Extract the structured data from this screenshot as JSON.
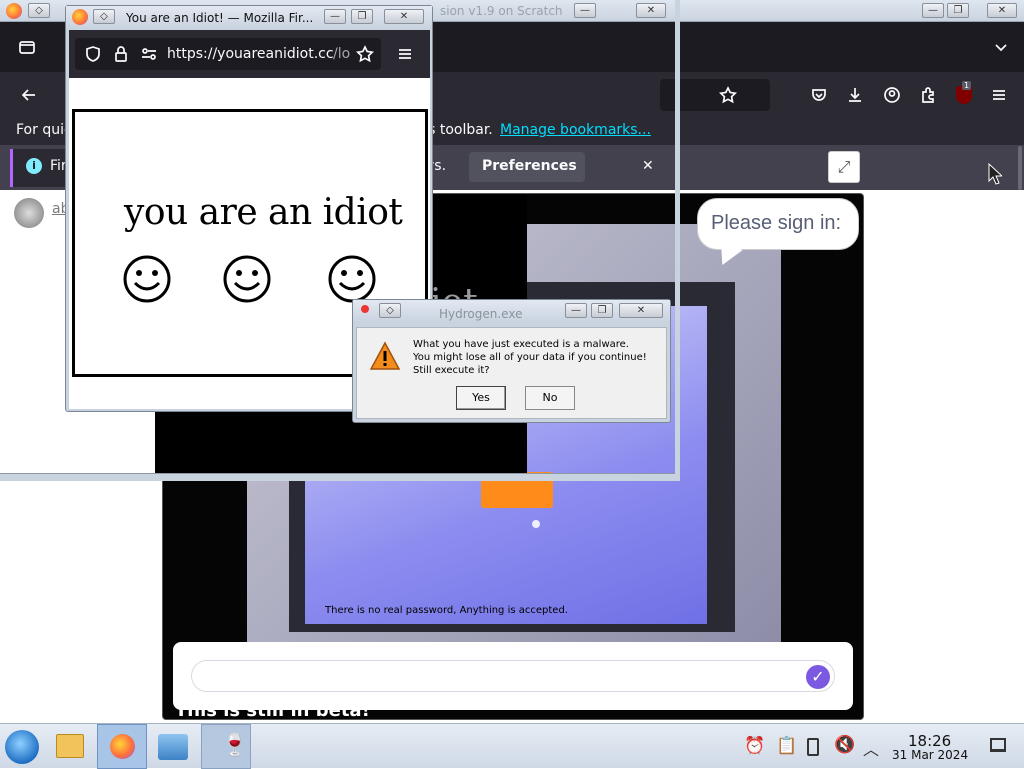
{
  "bg_window": {
    "title": "sion v1.9 on Scratch",
    "bookmarks_text": "Manage bookmarks...",
    "bookmarks_prefix": "For quic",
    "bookmarks_mid": "ks toolbar.",
    "ublock_badge": "1",
    "notice_text": "Fir",
    "notice_suffix": "ys.",
    "preferences_label": "Preferences",
    "link_text": "abo"
  },
  "scratch": {
    "speech_bubble": "Please sign in:",
    "caption": "There is no real password, Anything is accepted.",
    "beta_text": "This is still in beta!",
    "overlay_text": "iot"
  },
  "idiot_window": {
    "title": "You are an Idiot! — Mozilla Fir...",
    "url_host": "https://youareanidiot.cc",
    "url_path": "/lo",
    "headline": "you are an idiot"
  },
  "dialog": {
    "title": "Hydrogen.exe",
    "message_line1": "What you have just executed is a malware.",
    "message_line2": "You might lose all of your data if you continue!",
    "message_line3": "Still execute it?",
    "yes_label": "Yes",
    "no_label": "No"
  },
  "taskbar": {
    "time": "18:26",
    "date": "31 Mar 2024"
  },
  "colors": {
    "ff_dark": "#2b2a33",
    "ff_light": "#f0f0f4",
    "link": "#0061e0",
    "accent_purple": "#7b59e0",
    "taskbar_bg": "#dbe3ee",
    "orange_button": "#ff8c1a"
  }
}
